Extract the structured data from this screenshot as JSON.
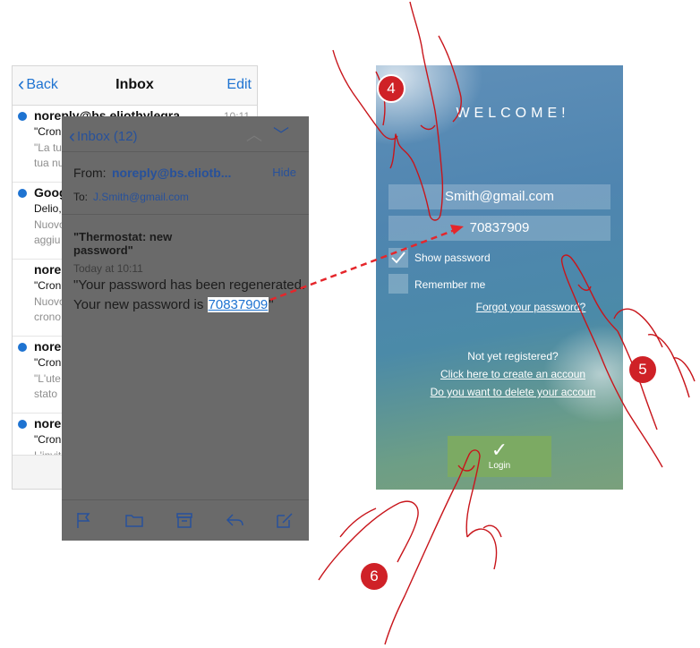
{
  "inbox": {
    "back_label": "Back",
    "title": "Inbox",
    "edit_label": "Edit",
    "items": [
      {
        "from": "noreply@bs.eliothylegra",
        "time": "10:11",
        "subject": "\"Cron",
        "preview1": "\"La tu",
        "preview2": "tua nu",
        "unread": true
      },
      {
        "from": "Goog",
        "time": "",
        "subject": "Delio,",
        "preview1": "Nuovo",
        "preview2": "aggiu",
        "unread": true
      },
      {
        "from": "nore",
        "time": "",
        "subject": "\"Cron",
        "preview1": "Nuovo",
        "preview2": "crono",
        "unread": false
      },
      {
        "from": "nore",
        "time": "",
        "subject": "\"Cron",
        "preview1": "\"L'ute",
        "preview2": "stato",
        "unread": true
      },
      {
        "from": "nore",
        "time": "",
        "subject": "\"Cron",
        "preview1": "L'invit",
        "preview2": "",
        "unread": true
      }
    ]
  },
  "message": {
    "back_label": "Inbox (12)",
    "from_label": "From:",
    "from_value": "noreply@bs.eliotb...",
    "hide_label": "Hide",
    "to_label": "To:",
    "to_value": "J.Smith@gmail.com",
    "subject_line1": "\"Thermostat: new",
    "subject_line2": "password\"",
    "date": "Today at 10:11",
    "body_line1": "\"Your password has been regenerated.",
    "body_line2_prefix": "Your new password is ",
    "password": "70837909",
    "body_line2_suffix": "\""
  },
  "login": {
    "welcome": "WELCOME!",
    "email_value": "Smith@gmail.com",
    "password_value": "70837909",
    "show_password_label": "Show password",
    "remember_me_label": "Remember me",
    "forgot_password_label": "Forgot your password?",
    "not_registered_label": "Not yet registered?",
    "create_account_label": "Click here to create an accoun",
    "delete_account_label": "Do you want to delete your accoun",
    "login_button_label": "Login",
    "check_glyph": "✓"
  },
  "steps": {
    "step4": "4",
    "step5": "5",
    "step6": "6"
  },
  "colors": {
    "accent_blue": "#1e73d1",
    "step_red": "#cf2127",
    "arrow_red": "#e5262b",
    "hand_outline": "#c8151b",
    "login_green": "#7caa63"
  }
}
